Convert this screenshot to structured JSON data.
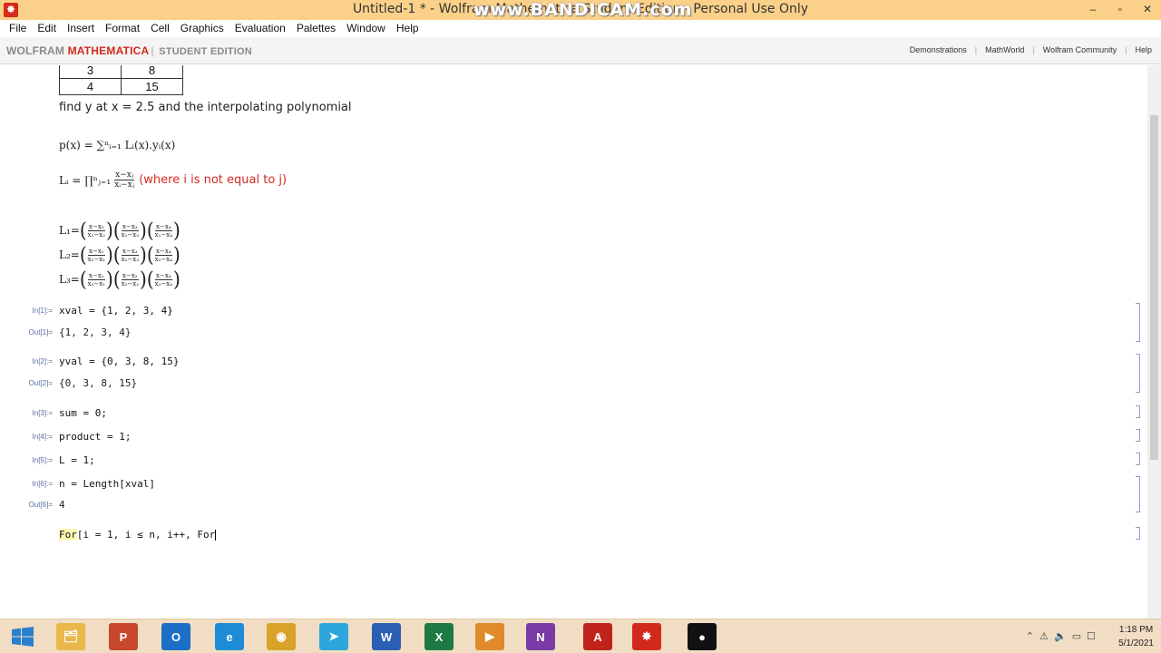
{
  "window": {
    "title": "Untitled-1 * - Wolfram Mathematica Student Edition - Personal Use Only",
    "watermark": "www.BANDICAM.com",
    "controls": [
      "–",
      "▫",
      "✕"
    ]
  },
  "menu": [
    "File",
    "Edit",
    "Insert",
    "Format",
    "Cell",
    "Graphics",
    "Evaluation",
    "Palettes",
    "Window",
    "Help"
  ],
  "brand": {
    "wolfram": "WOLFRAM",
    "mathematica": "MATHEMATICA",
    "edition": "STUDENT EDITION"
  },
  "links": [
    "Demonstrations",
    "MathWorld",
    "Wolfram Community",
    "Help"
  ],
  "notebook": {
    "table_rows": [
      [
        "3",
        "8"
      ],
      [
        "4",
        "15"
      ]
    ],
    "instruction": "find y at x = 2.5 and the interpolating polynomial",
    "p_formula": "p(x) = ∑ⁿᵢ₌₁ Lᵢ(x).yᵢ(x)",
    "l_formula": "Lᵢ = ∏ⁿⱼ₌₁",
    "l_num": "x−xⱼ",
    "l_den": "xᵢ−xⱼ",
    "l_note": "(where i is not equal to j)",
    "lagrange": [
      {
        "name": "L₁=",
        "fracs": [
          [
            "x−x₂",
            "x₁−x₂"
          ],
          [
            "x−x₃",
            "x₁−x₃"
          ],
          [
            "x−x₄",
            "x₁−x₄"
          ]
        ]
      },
      {
        "name": "L₂=",
        "fracs": [
          [
            "x−x₁",
            "x₂−x₁"
          ],
          [
            "x−x₃",
            "x₂−x₃"
          ],
          [
            "x−x₄",
            "x₂−x₄"
          ]
        ]
      },
      {
        "name": "L₃=",
        "fracs": [
          [
            "x−x₁",
            "x₃−x₁"
          ],
          [
            "x−x₂",
            "x₃−x₂"
          ],
          [
            "x−x₄",
            "x₃−x₄"
          ]
        ]
      }
    ],
    "cells": {
      "in1_label": "In[1]:=",
      "in1": "xval = {1, 2, 3, 4}",
      "out1_label": "Out[1]=",
      "out1": "{1, 2, 3, 4}",
      "in2_label": "In[2]:=",
      "in2": "yval = {0, 3, 8, 15}",
      "out2_label": "Out[2]=",
      "out2": "{0, 3, 8, 15}",
      "in3_label": "In[3]:=",
      "in3": "sum = 0;",
      "in4_label": "In[4]:=",
      "in4": "product = 1;",
      "in5_label": "In[5]:=",
      "in5": "L = 1;",
      "in6_label": "In[6]:=",
      "in6": "n = Length[xval]",
      "out6_label": "Out[6]=",
      "out6": "4",
      "current_kw": "For",
      "current_rest": "[i = 1, i ≤ n, i++, For"
    }
  },
  "taskbar": {
    "time": "1:18 PM",
    "date": "5/1/2021",
    "apps": [
      {
        "name": "file-explorer",
        "glyph": "🗂",
        "color": "#e8b84a"
      },
      {
        "name": "powerpoint",
        "glyph": "P",
        "color": "#c8472b"
      },
      {
        "name": "outlook",
        "glyph": "O",
        "color": "#1b6fc4"
      },
      {
        "name": "internet-explorer",
        "glyph": "e",
        "color": "#1e8bd6"
      },
      {
        "name": "chrome",
        "glyph": "◉",
        "color": "#d9a228"
      },
      {
        "name": "telegram",
        "glyph": "➤",
        "color": "#2ea6dd"
      },
      {
        "name": "word",
        "glyph": "W",
        "color": "#2b5fb4"
      },
      {
        "name": "excel",
        "glyph": "X",
        "color": "#1e7a44"
      },
      {
        "name": "media-player",
        "glyph": "▶",
        "color": "#e08a2a"
      },
      {
        "name": "onenote",
        "glyph": "N",
        "color": "#7a3aa6"
      },
      {
        "name": "acrobat",
        "glyph": "A",
        "color": "#c0221c"
      },
      {
        "name": "mathematica",
        "glyph": "✸",
        "color": "#d12a1c"
      },
      {
        "name": "bandicam",
        "glyph": "●",
        "color": "#111111"
      }
    ]
  }
}
